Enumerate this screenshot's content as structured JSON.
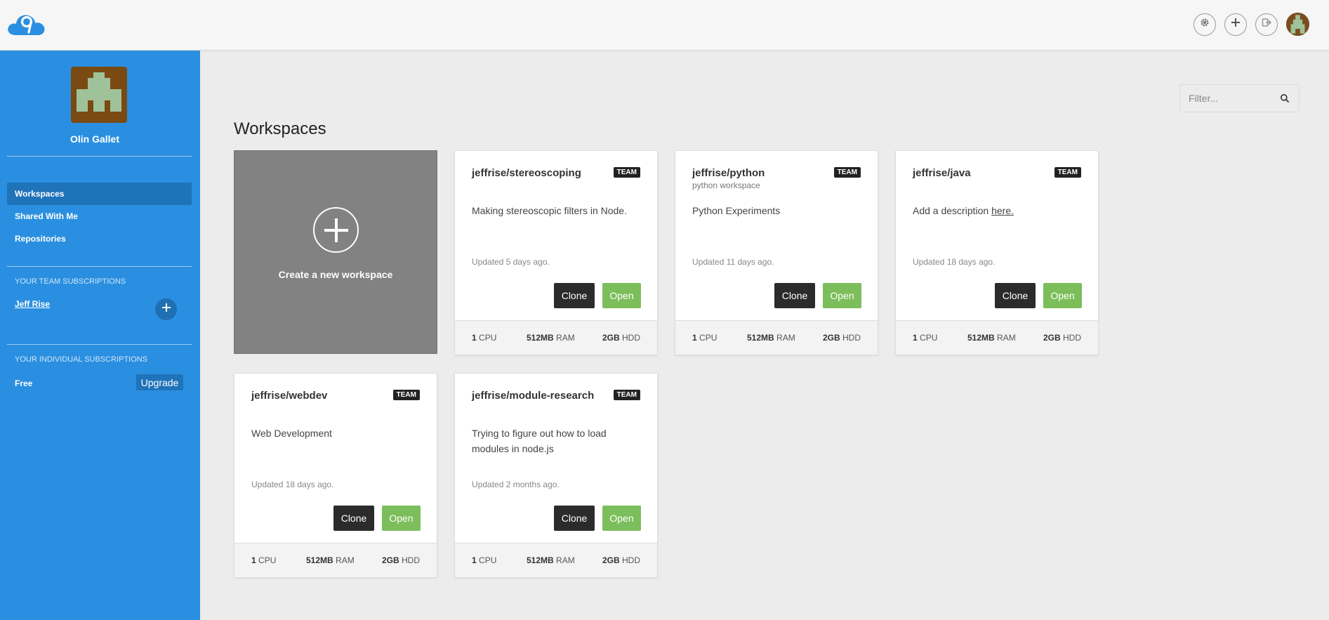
{
  "user": {
    "name": "Olin Gallet"
  },
  "sidebar": {
    "nav": [
      {
        "label": "Workspaces",
        "active": true
      },
      {
        "label": "Shared With Me",
        "active": false
      },
      {
        "label": "Repositories",
        "active": false
      }
    ],
    "team_title": "YOUR TEAM SUBSCRIPTIONS",
    "team_name": "Jeff Rise",
    "individual_title": "YOUR INDIVIDUAL SUBSCRIPTIONS",
    "plan": "Free",
    "upgrade_label": "Upgrade"
  },
  "header": {
    "icons": [
      "cloud9-logo-icon",
      "gear-icon",
      "plus-icon",
      "sign-out-icon",
      "avatar"
    ]
  },
  "main": {
    "title": "Workspaces",
    "filter_placeholder": "Filter...",
    "new_workspace_label": "Create a new workspace",
    "clone_label": "Clone",
    "open_label": "Open",
    "workspaces": [
      {
        "name": "jeffrise/stereoscoping",
        "subtitle": "",
        "badge": "TEAM",
        "description": "Making stereoscopic filters in Node.",
        "description_link": "",
        "updated": "Updated 5 days ago.",
        "cpu": "1",
        "cpu_unit": "CPU",
        "ram": "512MB",
        "ram_unit": "RAM",
        "hdd": "2GB",
        "hdd_unit": "HDD"
      },
      {
        "name": "jeffrise/python",
        "subtitle": "python workspace",
        "badge": "TEAM",
        "description": "Python Experiments",
        "description_link": "",
        "updated": "Updated 11 days ago.",
        "cpu": "1",
        "cpu_unit": "CPU",
        "ram": "512MB",
        "ram_unit": "RAM",
        "hdd": "2GB",
        "hdd_unit": "HDD"
      },
      {
        "name": "jeffrise/java",
        "subtitle": "",
        "badge": "TEAM",
        "description": "Add a description ",
        "description_link": "here.",
        "updated": "Updated 18 days ago.",
        "cpu": "1",
        "cpu_unit": "CPU",
        "ram": "512MB",
        "ram_unit": "RAM",
        "hdd": "2GB",
        "hdd_unit": "HDD"
      },
      {
        "name": "jeffrise/webdev",
        "subtitle": "",
        "badge": "TEAM",
        "description": "Web Development",
        "description_link": "",
        "updated": "Updated 18 days ago.",
        "cpu": "1",
        "cpu_unit": "CPU",
        "ram": "512MB",
        "ram_unit": "RAM",
        "hdd": "2GB",
        "hdd_unit": "HDD"
      },
      {
        "name": "jeffrise/module-research",
        "subtitle": "",
        "badge": "TEAM",
        "description": "Trying to figure out how to load modules in node.js",
        "description_link": "",
        "updated": "Updated 2 months ago.",
        "cpu": "1",
        "cpu_unit": "CPU",
        "ram": "512MB",
        "ram_unit": "RAM",
        "hdd": "2GB",
        "hdd_unit": "HDD"
      }
    ]
  },
  "colors": {
    "sidebar": "#2a8fe0",
    "sidebar_active": "#1f73b9",
    "open_button": "#7cbe5b",
    "clone_button": "#2b2b2b",
    "new_card": "#828282"
  }
}
